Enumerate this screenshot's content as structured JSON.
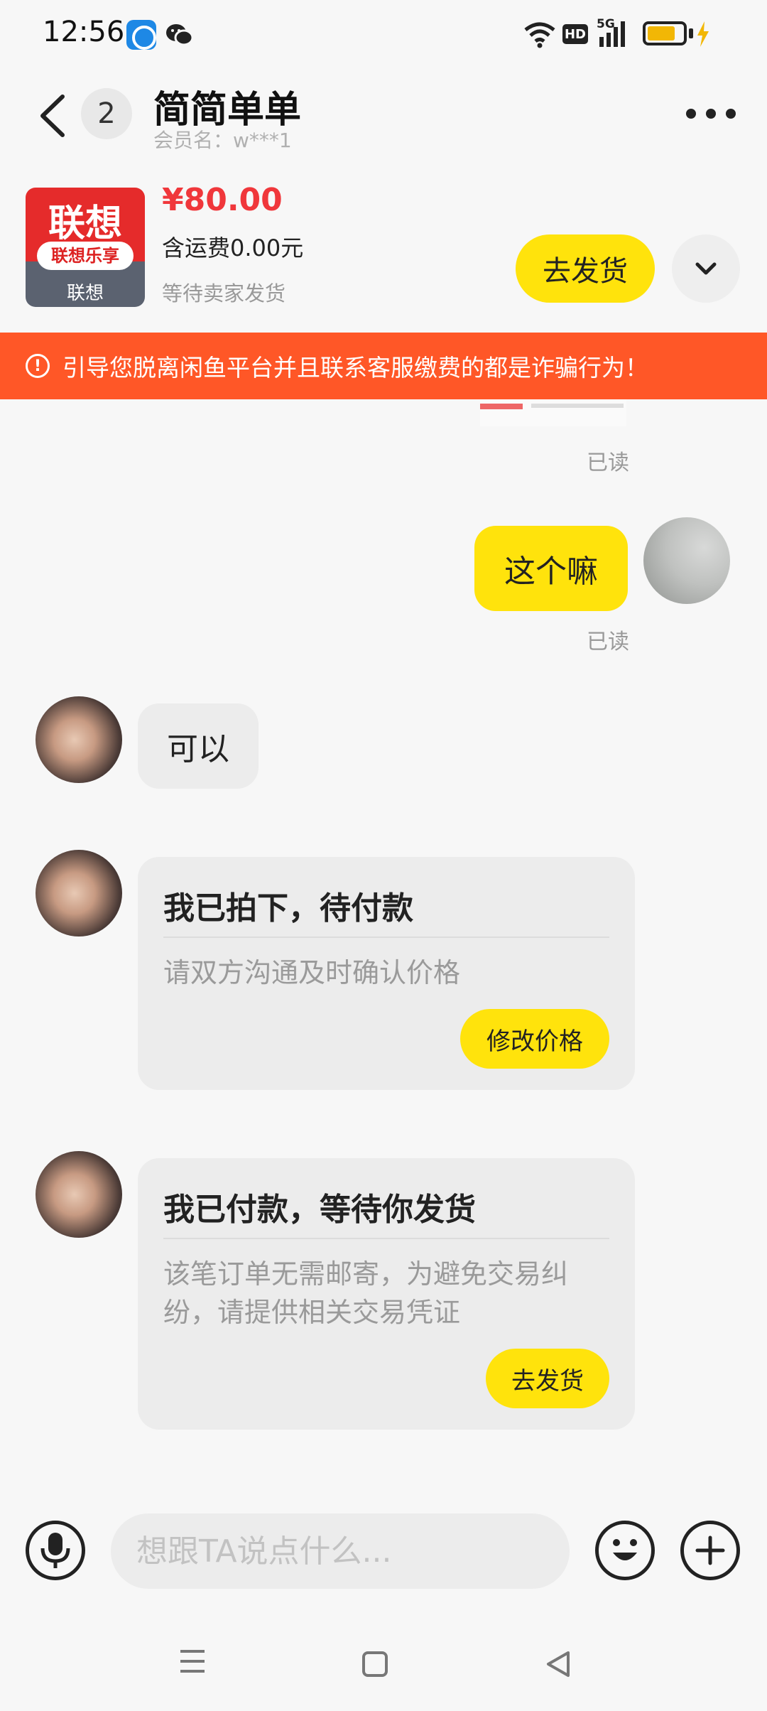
{
  "status_bar": {
    "time": "12:56",
    "network": "5G",
    "hd": "HD"
  },
  "header": {
    "unread_count": "2",
    "title": "简简单单",
    "member_label": "会员名：w***1"
  },
  "product": {
    "image_brand": "联想",
    "image_badge": "联想乐享",
    "image_footer": "联想",
    "price": "¥80.00",
    "shipping": "含运费0.00元",
    "status": "等待卖家发货",
    "ship_button": "去发货"
  },
  "warning": {
    "icon_glyph": "!",
    "text": "引导您脱离闲鱼平台并且联系客服缴费的都是诈骗行为！"
  },
  "messages": {
    "read1": "已读",
    "me_text": "这个嘛",
    "read2": "已读",
    "her_text": "可以",
    "card1": {
      "title": "我已拍下，待付款",
      "subtitle": "请双方沟通及时确认价格",
      "button": "修改价格"
    },
    "card2": {
      "title": "我已付款，等待你发货",
      "subtitle": "该笔订单无需邮寄，为避免交易纠纷，请提供相关交易凭证",
      "button": "去发货"
    }
  },
  "input": {
    "placeholder": "想跟TA说点什么..."
  },
  "colors": {
    "accent_yellow": "#ffe30c",
    "price_red": "#f0373b",
    "warning_orange": "#ff5727"
  }
}
